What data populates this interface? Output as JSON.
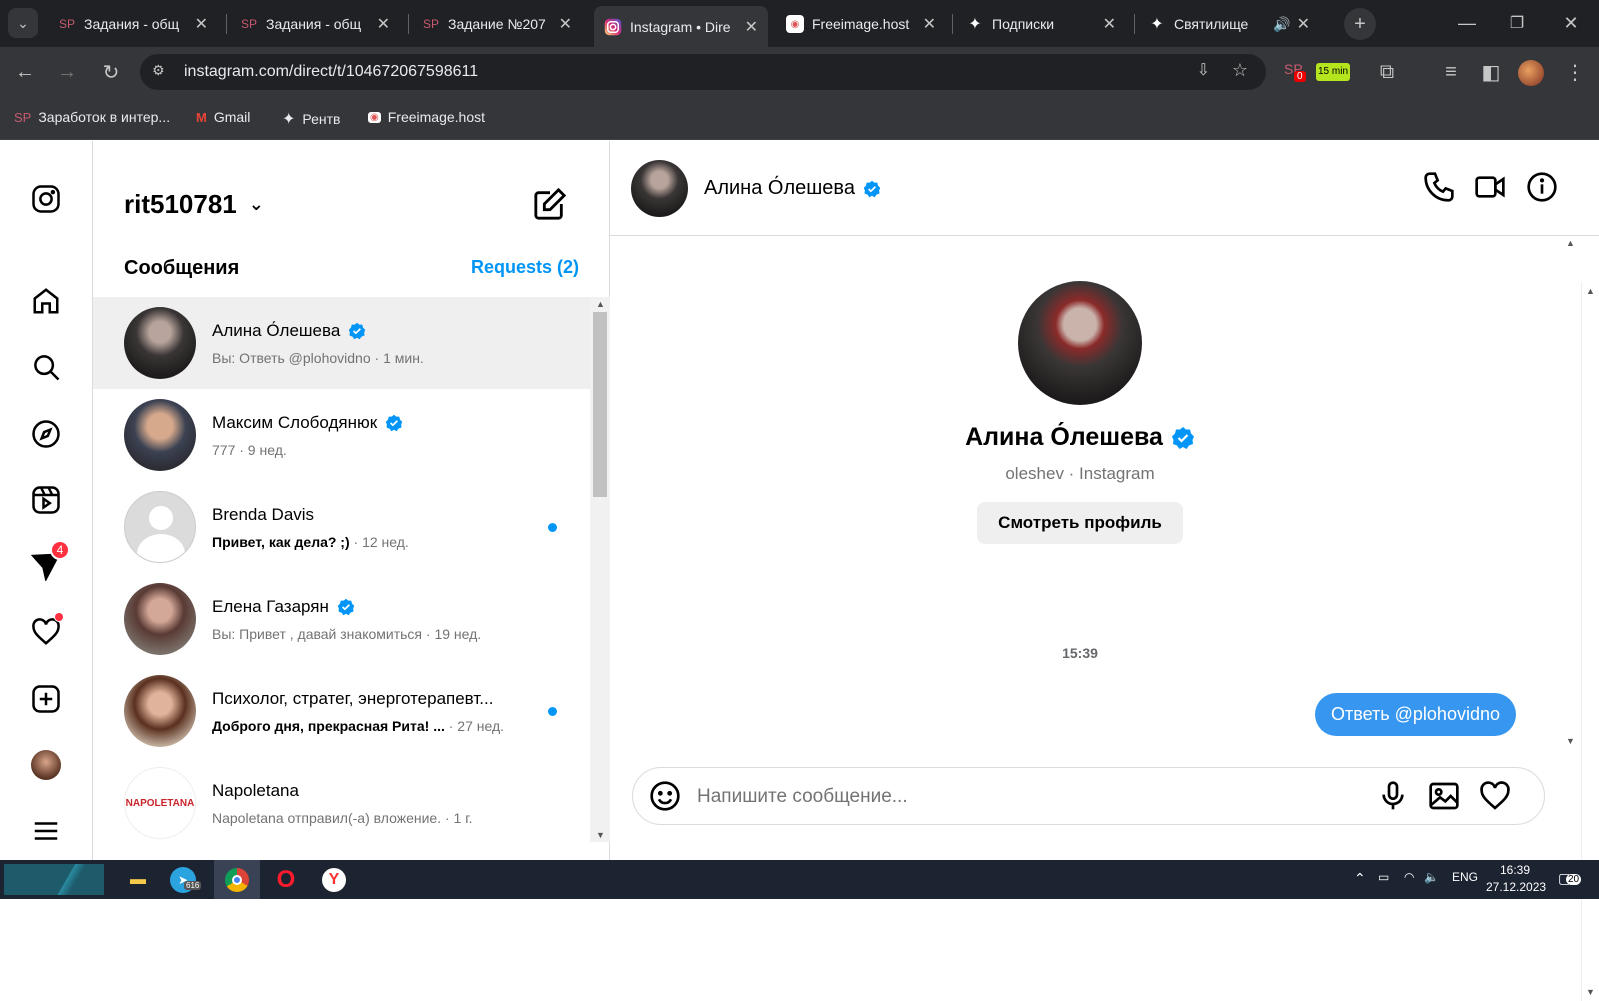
{
  "browser": {
    "tabs": [
      {
        "title": "Задания - общ",
        "favicon": "SP"
      },
      {
        "title": "Задания - общ",
        "favicon": "SP"
      },
      {
        "title": "Задание №207",
        "favicon": "SP"
      },
      {
        "title": "Instagram • Dire",
        "favicon": "instagram-icon"
      },
      {
        "title": "Freeimage.host",
        "favicon": "freeimage-icon"
      },
      {
        "title": "Подписки",
        "favicon": "star-icon"
      },
      {
        "title": "Святилище",
        "favicon": "star-icon"
      }
    ],
    "url": "instagram.com/direct/t/104672067598611",
    "ext_badge_sp": "0",
    "ext_badge_timer": "15 min",
    "bookmarks": [
      {
        "label": "Заработок в интер...",
        "favicon": "SP"
      },
      {
        "label": "Gmail",
        "favicon": "gmail-icon"
      },
      {
        "label": "Рентв",
        "favicon": "star-icon"
      },
      {
        "label": "Freeimage.host",
        "favicon": "freeimage-icon"
      }
    ]
  },
  "nav": {
    "messages_badge": "4"
  },
  "inbox": {
    "username": "rit510781",
    "section_title": "Сообщения",
    "requests_label": "Requests (2)",
    "threads": [
      {
        "name": "Алина О́лешева",
        "preview": "Вы: Ответь @plohovidno",
        "time": "· 1 мин.",
        "verified": true,
        "unread": false,
        "selected": true
      },
      {
        "name": "Максим Слободянюк",
        "preview": "777",
        "time": "· 9 нед.",
        "verified": true,
        "unread": false,
        "selected": false
      },
      {
        "name": "Brenda Davis",
        "preview": "Привет, как дела? ;)",
        "time": "· 12 нед.",
        "verified": false,
        "unread": true,
        "selected": false
      },
      {
        "name": "Елена Газарян",
        "preview": "Вы: Привет , давай знакомиться",
        "time": "· 19 нед.",
        "verified": true,
        "unread": false,
        "selected": false
      },
      {
        "name": "Психолог, стратег, энерготерапевт...",
        "preview": "Доброго дня, прекрасная Рита! ...",
        "time": "· 27 нед.",
        "verified": false,
        "unread": true,
        "selected": false
      },
      {
        "name": "Napoletana",
        "preview": "Napoletana отправил(-а) вложение.",
        "time": "· 1 г.",
        "verified": false,
        "unread": false,
        "selected": false
      }
    ],
    "napoletana_logo": "NAPOLETANA"
  },
  "chat": {
    "name": "Алина О́лешева",
    "profile_name": "Алина О́лешева",
    "profile_sub": "oleshev · Instagram",
    "profile_button": "Смотреть профиль",
    "timestamp": "15:39",
    "messages": [
      {
        "text": "Ответь @plohovidno",
        "from": "me"
      }
    ],
    "composer_placeholder": "Напишите сообщение..."
  },
  "taskbar": {
    "telegram_badge": "616",
    "lang": "ENG",
    "time": "16:39",
    "date": "27.12.2023",
    "notif_count": "20"
  },
  "colors": {
    "accent": "#0095f6",
    "bubble": "#3797f0",
    "badge": "#ff3040"
  }
}
